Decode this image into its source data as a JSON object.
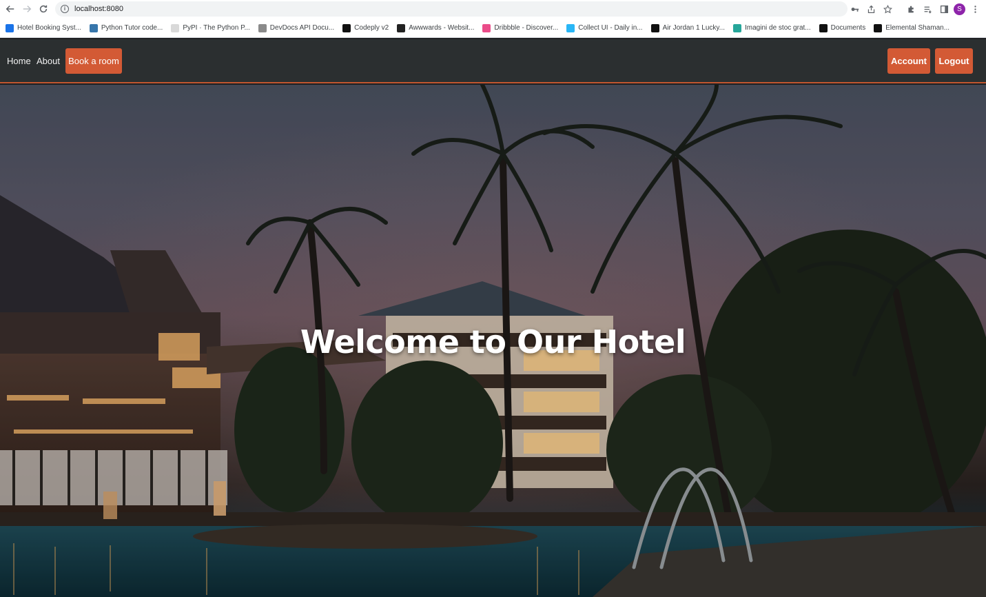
{
  "browser": {
    "url": "localhost:8080",
    "profile_initial": "S",
    "bookmarks": [
      {
        "label": "Hotel Booking Syst...",
        "icon": "f-logo-icon",
        "color": "#1a73e8"
      },
      {
        "label": "Python Tutor code...",
        "icon": "python-icon",
        "color": "#3776ab"
      },
      {
        "label": "PyPI · The Python P...",
        "icon": "pypi-icon",
        "color": "#d9d9d9"
      },
      {
        "label": "DevDocs API Docu...",
        "icon": "devdocs-icon",
        "color": "#8a8a8a"
      },
      {
        "label": "Codeply v2",
        "icon": "codeply-icon",
        "color": "#111111"
      },
      {
        "label": "Awwwards - Websit...",
        "icon": "awwwards-icon",
        "color": "#222222"
      },
      {
        "label": "Dribbble - Discover...",
        "icon": "dribbble-icon",
        "color": "#ea4c89"
      },
      {
        "label": "Collect UI - Daily in...",
        "icon": "collectui-icon",
        "color": "#29b6f6"
      },
      {
        "label": "Air Jordan 1 Lucky...",
        "icon": "jordan-icon",
        "color": "#111111"
      },
      {
        "label": "Imagini de stoc grat...",
        "icon": "stock-icon",
        "color": "#26a69a"
      },
      {
        "label": "Documents",
        "icon": "documents-icon",
        "color": "#111111"
      },
      {
        "label": "Elemental Shaman...",
        "icon": "wow-icon",
        "color": "#111111"
      }
    ]
  },
  "nav": {
    "home": "Home",
    "about": "About",
    "book": "Book a room",
    "account": "Account",
    "logout": "Logout",
    "accent_color": "#d35a35"
  },
  "hero": {
    "title": "Welcome to Our Hotel"
  }
}
